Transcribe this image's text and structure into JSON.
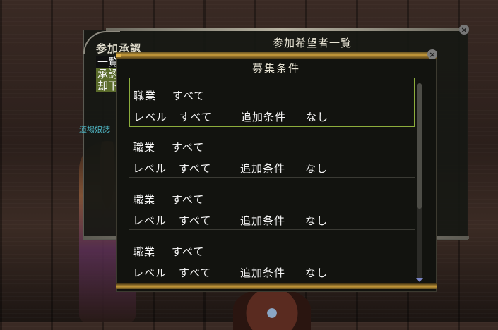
{
  "back_panel": {
    "tab_title": "参加承認",
    "title": "参加希望者一覧",
    "side_items": [
      "一覧",
      "承認",
      "却下"
    ],
    "side_note": "道場娘誌",
    "close_icon": "close-icon"
  },
  "front_panel": {
    "title": "募集条件",
    "close_icon": "close-icon",
    "rows": [
      {
        "job_label": "職業",
        "job_value": "すべて",
        "level_label": "レベル",
        "level_value": "すべて",
        "extra_label": "追加条件",
        "extra_value": "なし"
      },
      {
        "job_label": "職業",
        "job_value": "すべて",
        "level_label": "レベル",
        "level_value": "すべて",
        "extra_label": "追加条件",
        "extra_value": "なし"
      },
      {
        "job_label": "職業",
        "job_value": "すべて",
        "level_label": "レベル",
        "level_value": "すべて",
        "extra_label": "追加条件",
        "extra_value": "なし"
      },
      {
        "job_label": "職業",
        "job_value": "すべて",
        "level_label": "レベル",
        "level_value": "すべて",
        "extra_label": "追加条件",
        "extra_value": "なし"
      }
    ]
  },
  "colors": {
    "selection_border": "#8cad3c",
    "gold_trim": "#c79b3a",
    "panel_bg": "#12130f",
    "text": "#f4f4f4",
    "note_text": "#4fb6c4"
  }
}
